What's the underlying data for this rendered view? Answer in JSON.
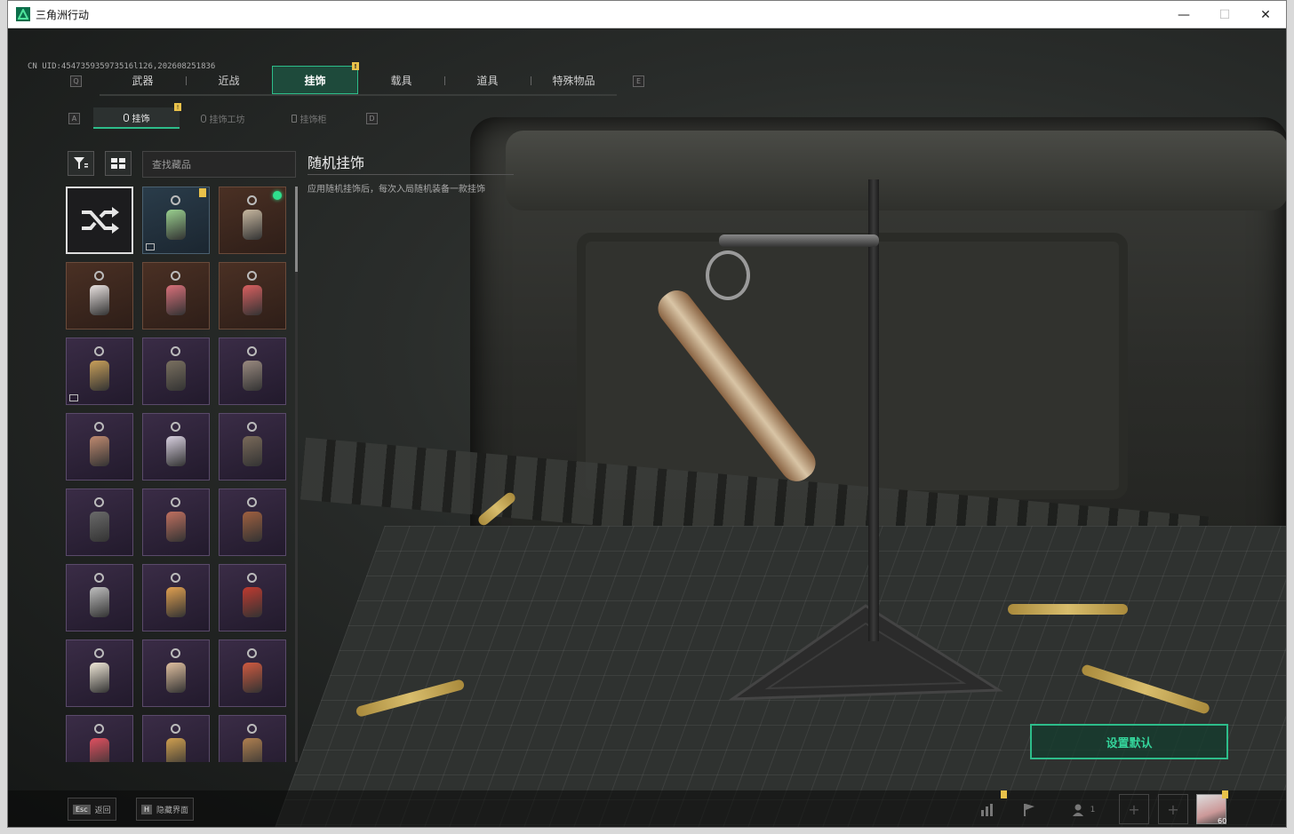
{
  "window": {
    "title": "三角洲行动",
    "controls": {
      "minimize": "—",
      "maximize": "☐",
      "close": "✕"
    }
  },
  "uid": "CN UID:454735935973516l126,202608251836",
  "top_tabs": {
    "left_key": "Q",
    "right_key": "E",
    "items": [
      {
        "label": "武器"
      },
      {
        "label": "近战"
      },
      {
        "label": "挂饰",
        "active": true,
        "badge": "!"
      },
      {
        "label": "载具"
      },
      {
        "label": "道具"
      },
      {
        "label": "特殊物品"
      }
    ]
  },
  "sub_tabs": {
    "left_key": "A",
    "right_key": "D",
    "items": [
      {
        "label": "挂饰",
        "active": true,
        "badge": "!"
      },
      {
        "label": "挂饰工坊"
      },
      {
        "label": "挂饰柜"
      }
    ]
  },
  "search": {
    "placeholder": "查找藏品"
  },
  "grid": {
    "items": [
      {
        "type": "random",
        "theme": "random"
      },
      {
        "theme": "blue",
        "badge": true,
        "img_icon": true,
        "color": "#9ad08f"
      },
      {
        "theme": "brown",
        "equipped": true,
        "color": "#c8b8a0"
      },
      {
        "theme": "brown",
        "color": "#e9e2e0"
      },
      {
        "theme": "brown",
        "color": "#d9707a"
      },
      {
        "theme": "brown",
        "color": "#d96060"
      },
      {
        "theme": "purple",
        "img_icon": true,
        "color": "#c9a05a"
      },
      {
        "theme": "purple",
        "color": "#7a7060"
      },
      {
        "theme": "purple",
        "color": "#9a8a80"
      },
      {
        "theme": "purple",
        "color": "#c08a70"
      },
      {
        "theme": "purple",
        "color": "#d8d0e0"
      },
      {
        "theme": "purple",
        "color": "#7a6a5a"
      },
      {
        "theme": "purple",
        "color": "#6a6a6a"
      },
      {
        "theme": "purple",
        "color": "#c07060"
      },
      {
        "theme": "purple",
        "color": "#a06040"
      },
      {
        "theme": "purple",
        "color": "#bfbfbf"
      },
      {
        "theme": "purple",
        "color": "#e0a050"
      },
      {
        "theme": "purple",
        "color": "#c03a30"
      },
      {
        "theme": "purple",
        "color": "#f0e8d8"
      },
      {
        "theme": "purple",
        "color": "#e0c0a0"
      },
      {
        "theme": "purple",
        "color": "#d05a40"
      },
      {
        "theme": "purple",
        "color": "#e05060"
      },
      {
        "theme": "purple",
        "color": "#d0a050"
      },
      {
        "theme": "purple",
        "color": "#b08050"
      }
    ]
  },
  "detail": {
    "title": "随机挂饰",
    "description": "应用随机挂饰后，每次入局随机装备一款挂饰"
  },
  "actions": {
    "set_default": "设置默认"
  },
  "bottom": {
    "esc_key": "Esc",
    "esc_label": "返回",
    "hide_key": "H",
    "hide_label": "隐藏界面",
    "friends_count": "1",
    "plus": "+",
    "level": "60"
  },
  "colors": {
    "accent": "#2dbd8a",
    "badge": "#e9c24a",
    "equipped": "#2fe08d"
  }
}
